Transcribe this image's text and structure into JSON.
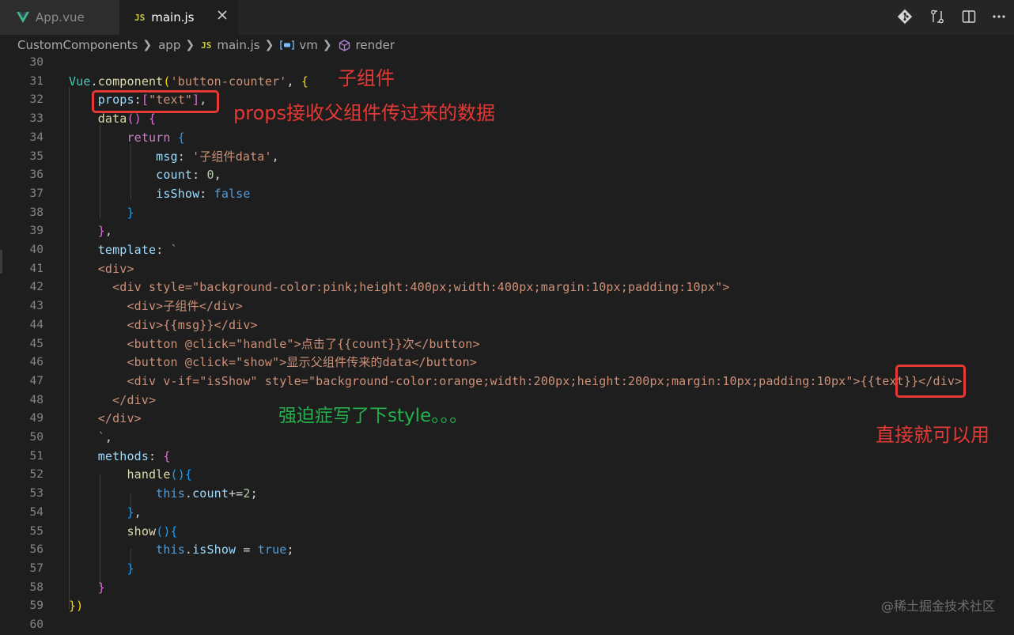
{
  "tabs": [
    {
      "label": "App.vue",
      "active": false,
      "icon": "vue-icon"
    },
    {
      "label": "main.js",
      "active": true,
      "icon": "js-icon",
      "icon_text": "JS"
    }
  ],
  "breadcrumb": [
    {
      "label": "CustomComponents"
    },
    {
      "label": "app"
    },
    {
      "label": "main.js",
      "icon_text": "JS"
    },
    {
      "label": "vm",
      "icon": "variable-icon"
    },
    {
      "label": "render",
      "icon": "method-cube-icon"
    }
  ],
  "editor": {
    "lines": [
      {
        "n": "30",
        "tokens": []
      },
      {
        "n": "31",
        "tokens": [
          [
            "c-cls",
            "Vue"
          ],
          [
            "c-pl",
            "."
          ],
          [
            "c-fn",
            "component"
          ],
          [
            "c-y",
            "("
          ],
          [
            "c-str",
            "'button-counter'"
          ],
          [
            "c-pl",
            ", "
          ],
          [
            "c-y",
            "{"
          ]
        ]
      },
      {
        "n": "32",
        "tokens": [
          [
            "c-pl",
            "    "
          ],
          [
            "c-prop",
            "props"
          ],
          [
            "c-pl",
            ":"
          ],
          [
            "c-m",
            "["
          ],
          [
            "c-str",
            "\"text\""
          ],
          [
            "c-m",
            "]"
          ],
          [
            "c-pl",
            ","
          ]
        ]
      },
      {
        "n": "33",
        "tokens": [
          [
            "c-pl",
            "    "
          ],
          [
            "c-fn",
            "data"
          ],
          [
            "c-m",
            "()"
          ],
          [
            "c-pl",
            " "
          ],
          [
            "c-m",
            "{"
          ]
        ]
      },
      {
        "n": "34",
        "tokens": [
          [
            "c-pl",
            "        "
          ],
          [
            "c-kw",
            "return"
          ],
          [
            "c-pl",
            " "
          ],
          [
            "c-b",
            "{"
          ]
        ]
      },
      {
        "n": "35",
        "tokens": [
          [
            "c-pl",
            "            "
          ],
          [
            "c-prop",
            "msg"
          ],
          [
            "c-pl",
            ": "
          ],
          [
            "c-str",
            "'子组件data'"
          ],
          [
            "c-pl",
            ","
          ]
        ]
      },
      {
        "n": "36",
        "tokens": [
          [
            "c-pl",
            "            "
          ],
          [
            "c-prop",
            "count"
          ],
          [
            "c-pl",
            ": "
          ],
          [
            "c-num",
            "0"
          ],
          [
            "c-pl",
            ","
          ]
        ]
      },
      {
        "n": "37",
        "tokens": [
          [
            "c-pl",
            "            "
          ],
          [
            "c-prop",
            "isShow"
          ],
          [
            "c-pl",
            ": "
          ],
          [
            "c-bool",
            "false"
          ]
        ]
      },
      {
        "n": "38",
        "tokens": [
          [
            "c-pl",
            "        "
          ],
          [
            "c-b",
            "}"
          ]
        ]
      },
      {
        "n": "39",
        "tokens": [
          [
            "c-pl",
            "    "
          ],
          [
            "c-m",
            "}"
          ],
          [
            "c-pl",
            ","
          ]
        ]
      },
      {
        "n": "40",
        "tokens": [
          [
            "c-pl",
            "    "
          ],
          [
            "c-prop",
            "template"
          ],
          [
            "c-pl",
            ": "
          ],
          [
            "c-str",
            "`"
          ]
        ]
      },
      {
        "n": "41",
        "tokens": [
          [
            "c-str",
            "    <div>"
          ]
        ]
      },
      {
        "n": "42",
        "tokens": [
          [
            "c-str",
            "      <div style=\"background-color:pink;height:400px;width:400px;margin:10px;padding:10px\">"
          ]
        ]
      },
      {
        "n": "43",
        "tokens": [
          [
            "c-str",
            "        <div>子组件</div>"
          ]
        ]
      },
      {
        "n": "44",
        "tokens": [
          [
            "c-str",
            "        <div>{{msg}}</div>"
          ]
        ]
      },
      {
        "n": "45",
        "tokens": [
          [
            "c-str",
            "        <button @click=\"handle\">点击了{{count}}次</button>"
          ]
        ]
      },
      {
        "n": "46",
        "tokens": [
          [
            "c-str",
            "        <button @click=\"show\">显示父组件传来的data</button>"
          ]
        ]
      },
      {
        "n": "47",
        "tokens": [
          [
            "c-str",
            "        <div v-if=\"isShow\" style=\"background-color:orange;width:200px;height:200px;margin:10px;padding:10px\">{{text}}</div>"
          ]
        ]
      },
      {
        "n": "48",
        "tokens": [
          [
            "c-str",
            "      </div>"
          ]
        ]
      },
      {
        "n": "49",
        "tokens": [
          [
            "c-str",
            "    </div>"
          ]
        ]
      },
      {
        "n": "50",
        "tokens": [
          [
            "c-str",
            "    `"
          ],
          [
            "c-pl",
            ","
          ]
        ]
      },
      {
        "n": "51",
        "tokens": [
          [
            "c-pl",
            "    "
          ],
          [
            "c-prop",
            "methods"
          ],
          [
            "c-pl",
            ": "
          ],
          [
            "c-m",
            "{"
          ]
        ]
      },
      {
        "n": "52",
        "tokens": [
          [
            "c-pl",
            "        "
          ],
          [
            "c-fn",
            "handle"
          ],
          [
            "c-b",
            "(){"
          ]
        ]
      },
      {
        "n": "53",
        "tokens": [
          [
            "c-pl",
            "            "
          ],
          [
            "c-bool",
            "this"
          ],
          [
            "c-pl",
            "."
          ],
          [
            "c-prop",
            "count"
          ],
          [
            "c-pl",
            "+="
          ],
          [
            "c-num",
            "2"
          ],
          [
            "c-pl",
            ";"
          ]
        ]
      },
      {
        "n": "54",
        "tokens": [
          [
            "c-pl",
            "        "
          ],
          [
            "c-b",
            "}"
          ],
          [
            "c-pl",
            ","
          ]
        ]
      },
      {
        "n": "55",
        "tokens": [
          [
            "c-pl",
            "        "
          ],
          [
            "c-fn",
            "show"
          ],
          [
            "c-b",
            "(){"
          ]
        ]
      },
      {
        "n": "56",
        "tokens": [
          [
            "c-pl",
            "            "
          ],
          [
            "c-bool",
            "this"
          ],
          [
            "c-pl",
            "."
          ],
          [
            "c-prop",
            "isShow"
          ],
          [
            "c-pl",
            " = "
          ],
          [
            "c-bool",
            "true"
          ],
          [
            "c-pl",
            ";"
          ]
        ]
      },
      {
        "n": "57",
        "tokens": [
          [
            "c-pl",
            "        "
          ],
          [
            "c-b",
            "}"
          ]
        ]
      },
      {
        "n": "58",
        "tokens": [
          [
            "c-pl",
            "    "
          ],
          [
            "c-m",
            "}"
          ]
        ]
      },
      {
        "n": "59",
        "tokens": [
          [
            "c-y",
            "})"
          ]
        ]
      },
      {
        "n": "60",
        "tokens": []
      }
    ]
  },
  "annotations": {
    "child_component": "子组件",
    "props_note": "props接收父组件传过来的数据",
    "style_note": "强迫症写了下style。。。",
    "direct_use": "直接就可以用"
  },
  "colors": {
    "annotation_red": "#e53935",
    "annotation_green": "#22b14c"
  },
  "watermark": "@稀土掘金技术社区"
}
